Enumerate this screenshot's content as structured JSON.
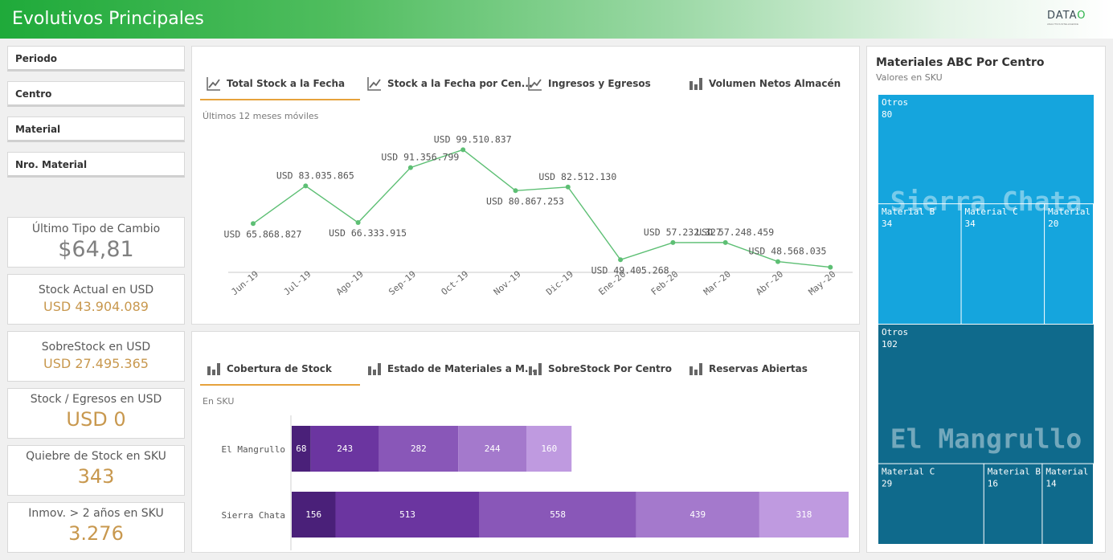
{
  "header": {
    "title": "Evolutivos Principales",
    "logo_word": "DATA",
    "logo_o": "O",
    "logo_tag": "ANALYTICS INTELLIGENCE"
  },
  "filters": [
    "Periodo",
    "Centro",
    "Material",
    "Nro. Material"
  ],
  "kpis": [
    {
      "label": "Último Tipo de Cambio",
      "value": "$64,81",
      "color": "#808080"
    },
    {
      "label": "Stock Actual en USD",
      "value": "USD 43.904.089",
      "color": "#c8984e"
    },
    {
      "label": "SobreStock en USD",
      "value": "USD 27.495.365",
      "color": "#c8984e"
    },
    {
      "label": "Stock / Egresos en USD",
      "value": "USD 0",
      "color": "#c8984e"
    },
    {
      "label": "Quiebre de Stock en SKU",
      "value": "343",
      "color": "#c8984e"
    },
    {
      "label": "Inmov. > 2 años en SKU",
      "value": "3.276",
      "color": "#c8984e"
    }
  ],
  "top_panel": {
    "tabs": [
      {
        "label": "Total Stock a la Fecha",
        "icon": "line-chart-icon",
        "active": true
      },
      {
        "label": "Stock a la Fecha por Cen...",
        "icon": "line-chart-icon",
        "active": false
      },
      {
        "label": "Ingresos y Egresos",
        "icon": "line-chart-icon",
        "active": false
      },
      {
        "label": "Volumen Netos Almacén",
        "icon": "bar-chart-icon",
        "active": false
      }
    ],
    "subtitle": "Últimos 12 meses móviles"
  },
  "bottom_panel": {
    "tabs": [
      {
        "label": "Cobertura de Stock",
        "icon": "bar-chart-icon",
        "active": true
      },
      {
        "label": "Estado de Materiales a M...",
        "icon": "bar-chart-icon",
        "active": false
      },
      {
        "label": "SobreStock Por Centro",
        "icon": "bar-chart-icon",
        "active": false
      },
      {
        "label": "Reservas Abiertas",
        "icon": "bar-chart-icon",
        "active": false
      }
    ],
    "subtitle": "En SKU"
  },
  "right_panel": {
    "title": "Materiales ABC Por Centro",
    "subtitle": "Valores en SKU"
  },
  "chart_data": [
    {
      "type": "line",
      "x": [
        "Jun-19",
        "Jul-19",
        "Ago-19",
        "Sep-19",
        "Oct-19",
        "Nov-19",
        "Dic-19",
        "Ene-20",
        "Feb-20",
        "Mar-20",
        "Abr-20",
        "May-20"
      ],
      "values": [
        65868827,
        83035865,
        66333915,
        91356799,
        99510837,
        80867253,
        82512130,
        49405268,
        57232327,
        57248459,
        48568035,
        46000000
      ],
      "labels": [
        "USD 65.868.827",
        "USD 83.035.865",
        "USD 66.333.915",
        "USD 91.356.799",
        "USD 99.510.837",
        "USD 80.867.253",
        "USD 82.512.130",
        "USD 49.405.268",
        "USD 57.232.327",
        "USD 57.248.459",
        "USD 48.568.035",
        ""
      ],
      "color": "#5dbf74"
    },
    {
      "type": "bar",
      "orientation": "horizontal",
      "stacked": true,
      "categories": [
        "El Mangrullo",
        "Sierra Chata"
      ],
      "series": [
        {
          "values": [
            68,
            156
          ],
          "color": "#4a2079"
        },
        {
          "values": [
            243,
            513
          ],
          "color": "#6b35a0"
        },
        {
          "values": [
            282,
            558
          ],
          "color": "#8957b8"
        },
        {
          "values": [
            244,
            439
          ],
          "color": "#a479cc"
        },
        {
          "values": [
            160,
            318
          ],
          "color": "#bf9ae0"
        }
      ]
    },
    {
      "type": "treemap",
      "groups": [
        {
          "name": "Sierra Chata",
          "color": "#15a5dd",
          "items": [
            {
              "name": "Otros",
              "value": 80
            },
            {
              "name": "Material B",
              "value": 34
            },
            {
              "name": "Material C",
              "value": 34
            },
            {
              "name": "Material A",
              "value": 20
            }
          ]
        },
        {
          "name": "El Mangrullo",
          "color": "#0f6a8c",
          "items": [
            {
              "name": "Otros",
              "value": 102
            },
            {
              "name": "Material C",
              "value": 29
            },
            {
              "name": "Material B",
              "value": 16
            },
            {
              "name": "Material A",
              "value": 14
            }
          ]
        }
      ]
    }
  ]
}
